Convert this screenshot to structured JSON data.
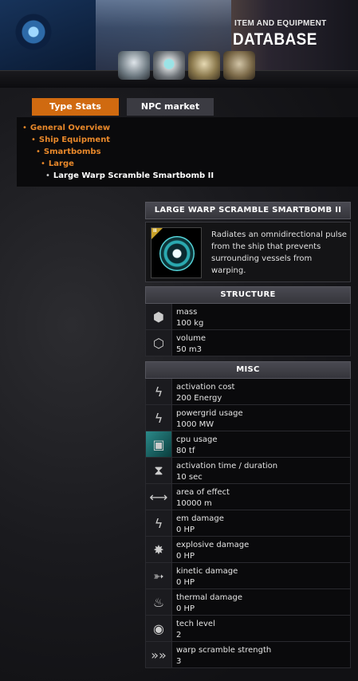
{
  "header": {
    "title_small": "ITEM AND EQUIPMENT",
    "title_big": "DATABASE"
  },
  "tabs": [
    {
      "label": "Type Stats",
      "active": true
    },
    {
      "label": "NPC market",
      "active": false
    }
  ],
  "breadcrumb": [
    "General Overview",
    "Ship Equipment",
    "Smartbombs",
    "Large",
    "Large Warp Scramble Smartbomb II"
  ],
  "item": {
    "name": "LARGE WARP SCRAMBLE SMARTBOMB II",
    "tech_badge": "II",
    "description": "Radiates an omnidirectional pulse from the ship that prevents surrounding vessels from warping."
  },
  "structure": {
    "header": "STRUCTURE",
    "rows": [
      {
        "icon": "mass-icon",
        "label": "mass",
        "value": "100 kg"
      },
      {
        "icon": "volume-icon",
        "label": "volume",
        "value": "50 m3"
      }
    ]
  },
  "misc": {
    "header": "MISC",
    "rows": [
      {
        "icon": "energy-icon",
        "label": "activation cost",
        "value": "200 Energy"
      },
      {
        "icon": "powergrid-icon",
        "label": "powergrid usage",
        "value": "1000 MW"
      },
      {
        "icon": "cpu-icon",
        "label": "cpu usage",
        "value": "80 tf"
      },
      {
        "icon": "hourglass-icon",
        "label": "activation time / duration",
        "value": "10 sec"
      },
      {
        "icon": "area-of-effect-icon",
        "label": "area of effect",
        "value": "10000 m"
      },
      {
        "icon": "em-damage-icon",
        "label": "em damage",
        "value": "0 HP"
      },
      {
        "icon": "explosive-damage-icon",
        "label": "explosive damage",
        "value": "0 HP"
      },
      {
        "icon": "kinetic-damage-icon",
        "label": "kinetic damage",
        "value": "0 HP"
      },
      {
        "icon": "thermal-damage-icon",
        "label": "thermal damage",
        "value": "0 HP"
      },
      {
        "icon": "tech-level-icon",
        "label": "tech level",
        "value": "2"
      },
      {
        "icon": "warp-scramble-icon",
        "label": "warp scramble strength",
        "value": "3"
      }
    ]
  },
  "colors": {
    "accent": "#d06a10",
    "breadcrumb": "#e8882a",
    "tab_inactive": "#3b3b42"
  }
}
